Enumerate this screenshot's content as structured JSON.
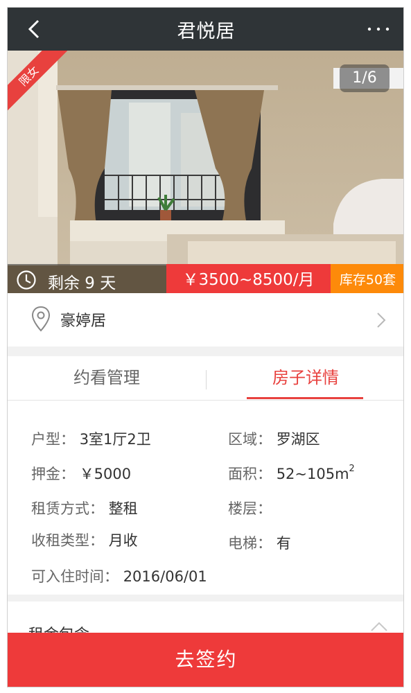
{
  "header": {
    "title": "君悦居"
  },
  "hero": {
    "ribbon": "限女",
    "counter": "1/6",
    "remain": "剩余 9 天",
    "price": "￥3500~8500/月",
    "stock": "库存50套"
  },
  "address": {
    "name": "豪婷居"
  },
  "tabs": [
    {
      "label": "约看管理"
    },
    {
      "label": "房子详情"
    }
  ],
  "details": {
    "huxing_label": "户型：",
    "huxing_value": "3室1厅2卫",
    "quyu_label": "区域：",
    "quyu_value": "罗湖区",
    "yajin_label": "押金：",
    "yajin_value": "￥5000",
    "mianji_label": "面积：",
    "mianji_value": "52~105m",
    "mianji_sup": "2",
    "zulin_label": "租赁方式：",
    "zulin_value": "整租",
    "louceng_label": "楼层：",
    "shouzu_label": "收租类型：",
    "shouzu_value": "月收",
    "dianti_label": "电梯：",
    "dianti_value": "有",
    "ruzhu_label": "可入住时间：",
    "ruzhu_value": "2016/06/01"
  },
  "rent": {
    "title": "租金包含"
  },
  "footer": {
    "sign_label": "去签约"
  },
  "colors": {
    "accent": "#ee3a3a",
    "stock": "#fd8a0a",
    "header": "#2f3437"
  }
}
